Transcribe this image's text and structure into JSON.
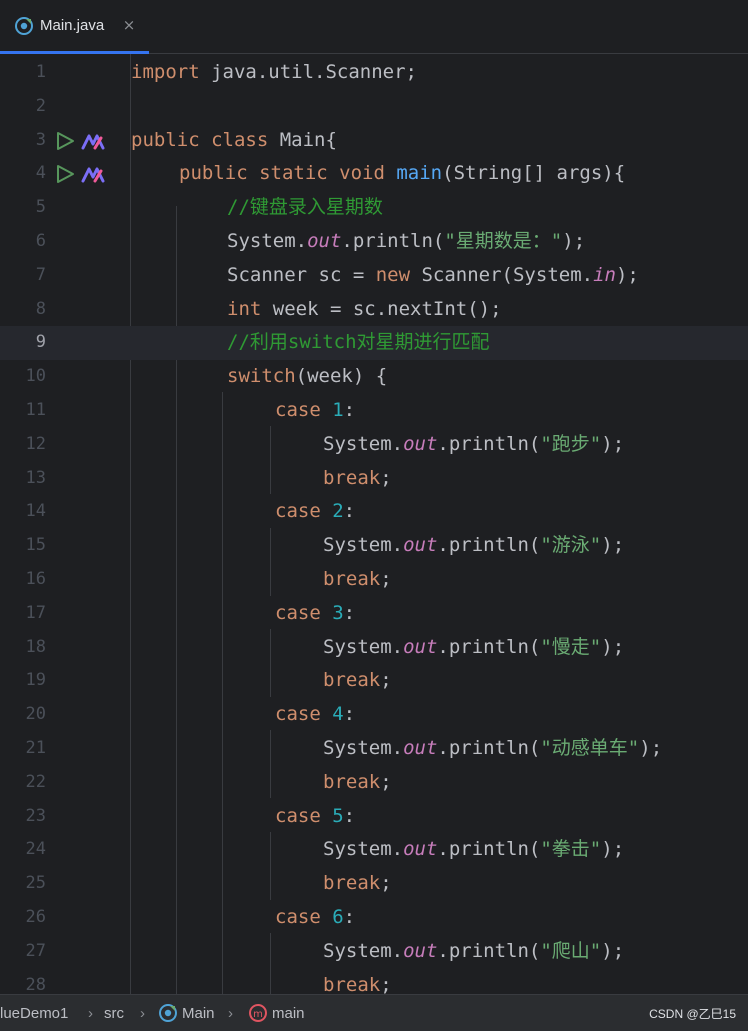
{
  "tab": {
    "title": "Main.java",
    "close": "×",
    "icon": "java-class-icon"
  },
  "code_lines": [
    {
      "num": "1"
    },
    {
      "num": "2"
    },
    {
      "num": "3"
    },
    {
      "num": "4"
    },
    {
      "num": "5"
    },
    {
      "num": "6"
    },
    {
      "num": "7"
    },
    {
      "num": "8"
    },
    {
      "num": "9"
    },
    {
      "num": "10"
    },
    {
      "num": "11"
    },
    {
      "num": "12"
    },
    {
      "num": "13"
    },
    {
      "num": "14"
    },
    {
      "num": "15"
    },
    {
      "num": "16"
    },
    {
      "num": "17"
    },
    {
      "num": "18"
    },
    {
      "num": "19"
    },
    {
      "num": "20"
    },
    {
      "num": "21"
    },
    {
      "num": "22"
    },
    {
      "num": "23"
    },
    {
      "num": "24"
    },
    {
      "num": "25"
    },
    {
      "num": "26"
    },
    {
      "num": "27"
    },
    {
      "num": "28"
    }
  ],
  "code": {
    "l1_import": "import",
    "l1_rest": " java.util.Scanner;",
    "l3_public": "public",
    "l3_class": "class",
    "l3_rest": " Main{",
    "l4_mods": "public static void",
    "l4_main": "main",
    "l4_rest": "(String[] args){",
    "l5_comment": "//键盘录入星期数",
    "l6_a": "System.",
    "l6_out": "out",
    "l6_b": ".println(",
    "l6_str": "\"星期数是：\"",
    "l6_c": ");",
    "l7_a": "Scanner sc = ",
    "l7_new": "new",
    "l7_b": " Scanner(System.",
    "l7_in": "in",
    "l7_c": ");",
    "l8_int": "int",
    "l8_rest": " week = sc.nextInt();",
    "l9_comment": "//利用switch对星期进行匹配",
    "l10_switch": "switch",
    "l10_rest": "(week) {",
    "case_kw": "case",
    "colon": ":",
    "println_a": "System.",
    "println_out": "out",
    "println_b": ".println(",
    "println_c": ");",
    "break_kw": "break",
    "semicolon": ";",
    "cases": [
      {
        "num": "1",
        "str": "\"跑步\""
      },
      {
        "num": "2",
        "str": "\"游泳\""
      },
      {
        "num": "3",
        "str": "\"慢走\""
      },
      {
        "num": "4",
        "str": "\"动感单车\""
      },
      {
        "num": "5",
        "str": "\"拳击\""
      },
      {
        "num": "6",
        "str": "\"爬山\""
      }
    ]
  },
  "current_line": 9,
  "gutter_icons": [
    "run-icon",
    "m-icon"
  ],
  "breadcrumbs": {
    "project": "lueDemo1",
    "src": "src",
    "class": "Main",
    "method": "main",
    "sep": "›"
  },
  "watermark": "CSDN @乙巳15",
  "colors": {
    "keyword": "#cf8e6d",
    "function": "#56a8f5",
    "static_field": "#c77dbb",
    "string": "#6aab73",
    "number": "#2aacb8",
    "comment": "#2f9a34",
    "text": "#bcbec4",
    "accent": "#3574f0"
  }
}
